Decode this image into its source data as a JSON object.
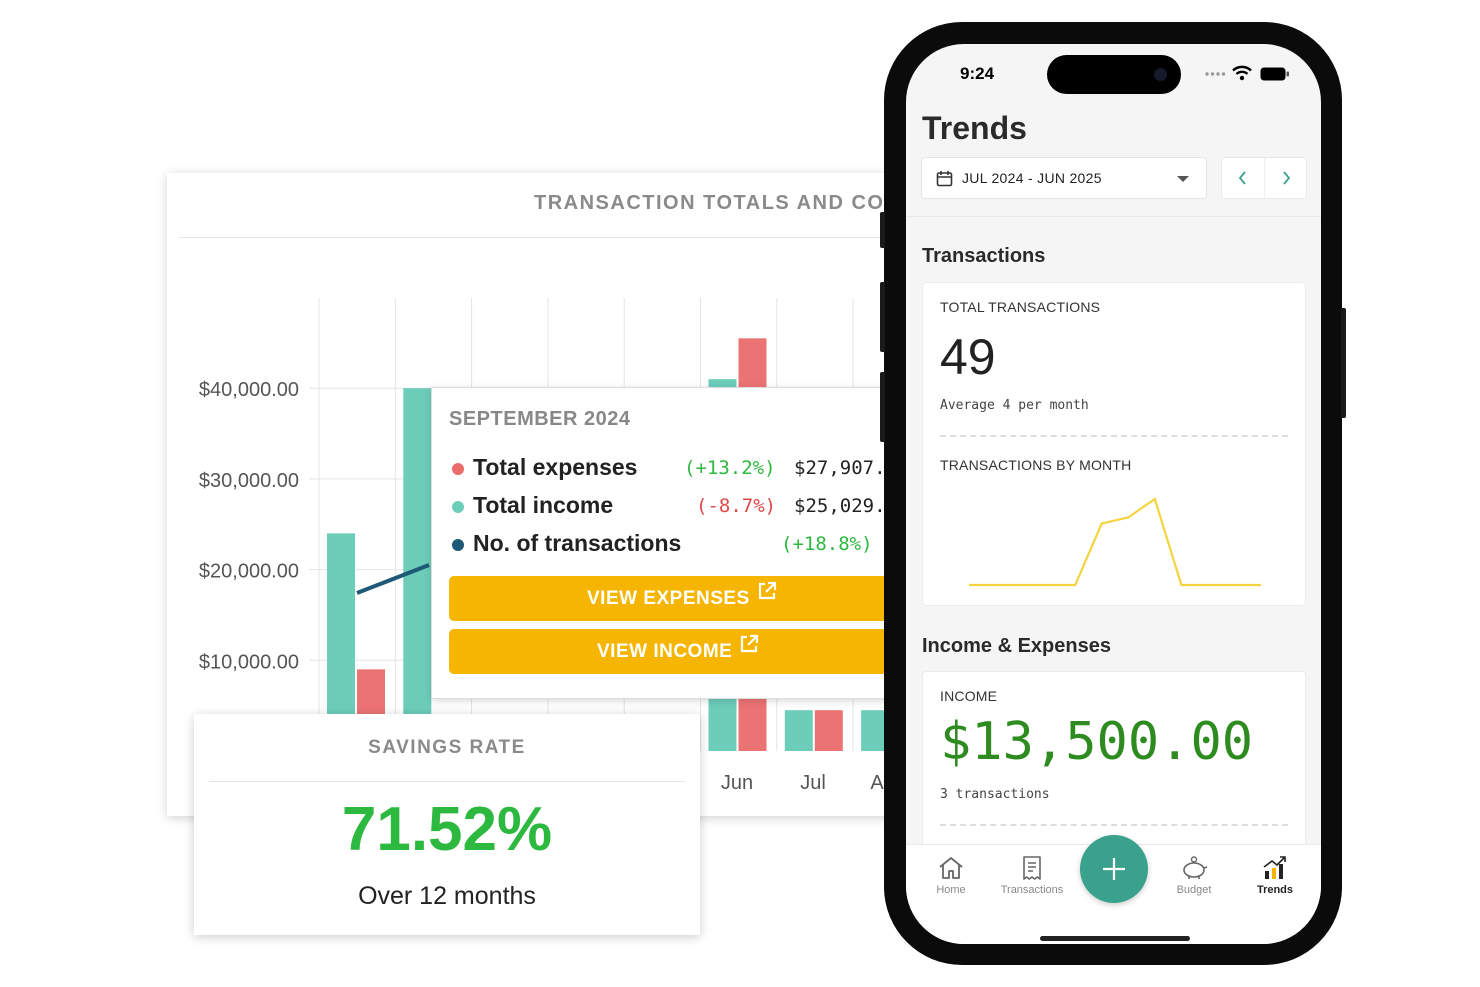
{
  "chart": {
    "title": "TRANSACTION TOTALS AND CO",
    "y_ticks": [
      "$40,000.00",
      "$30,000.00",
      "$20,000.00",
      "$10,000.00"
    ],
    "x_ticks": [
      "Jun",
      "Jul",
      "A"
    ]
  },
  "chart_data": {
    "type": "bar",
    "title": "TRANSACTION TOTALS AND CO",
    "categories": [
      "",
      "",
      "",
      "",
      "",
      "",
      "",
      "",
      ""
    ],
    "x_tick_labels_visible": [
      "Jun",
      "Jul",
      "A"
    ],
    "y_tick_labels": [
      "$10,000.00",
      "$20,000.00",
      "$30,000.00",
      "$40,000.00"
    ],
    "ylim": [
      0,
      50000
    ],
    "series": [
      {
        "values": [
          24000,
          40000,
          null,
          null,
          null,
          41000,
          4500,
          4500,
          4500
        ],
        "color": "#6ccdb9"
      },
      {
        "values": [
          9000,
          null,
          null,
          null,
          null,
          45500,
          4500,
          4500,
          null
        ],
        "color": "#ec7373"
      }
    ],
    "line_segment_color": "#1e5a78",
    "grid": true
  },
  "tooltip": {
    "title": "SEPTEMBER 2024",
    "rows": [
      {
        "label": "Total expenses",
        "pct": "(+13.2%)",
        "value": "$27,907.",
        "dot_color": "#ec6b6b",
        "pct_color": "#2db83f"
      },
      {
        "label": "Total income",
        "pct": "(-8.7%)",
        "value": "$25,029.",
        "dot_color": "#6ccdb9",
        "pct_color": "#e04848"
      },
      {
        "label": "No. of transactions",
        "pct": "(+18.8%)",
        "value": "",
        "dot_color": "#1e5a78",
        "pct_color": "#2db83f"
      }
    ],
    "view_expenses": "VIEW EXPENSES",
    "view_income": "VIEW INCOME"
  },
  "savings": {
    "title": "SAVINGS RATE",
    "value": "71.52%",
    "subtitle": "Over 12 months"
  },
  "phone": {
    "status_time": "9:24",
    "title": "Trends",
    "date_range": "JUL 2024 - JUN 2025",
    "transactions_section": "Transactions",
    "total_transactions_label": "TOTAL TRANSACTIONS",
    "total_transactions_value": "49",
    "average_text": "Average 4 per month",
    "by_month_label": "TRANSACTIONS BY MONTH",
    "by_month_series": [
      0,
      0,
      0,
      0,
      0,
      10,
      11,
      14,
      0,
      0,
      0,
      0
    ],
    "sparkline_color": "#f4d43e",
    "income_section": "Income & Expenses",
    "income_label": "INCOME",
    "income_value": "$13,500.00",
    "income_sub": "3 transactions",
    "tabs": [
      {
        "label": "Home",
        "icon": "home-icon"
      },
      {
        "label": "Transactions",
        "icon": "receipt-icon"
      },
      {
        "label": "Budget",
        "icon": "piggy-bank-icon"
      },
      {
        "label": "Trends",
        "icon": "trends-icon"
      }
    ],
    "fab_icon": "plus-icon",
    "accent": "#3aa28c"
  }
}
